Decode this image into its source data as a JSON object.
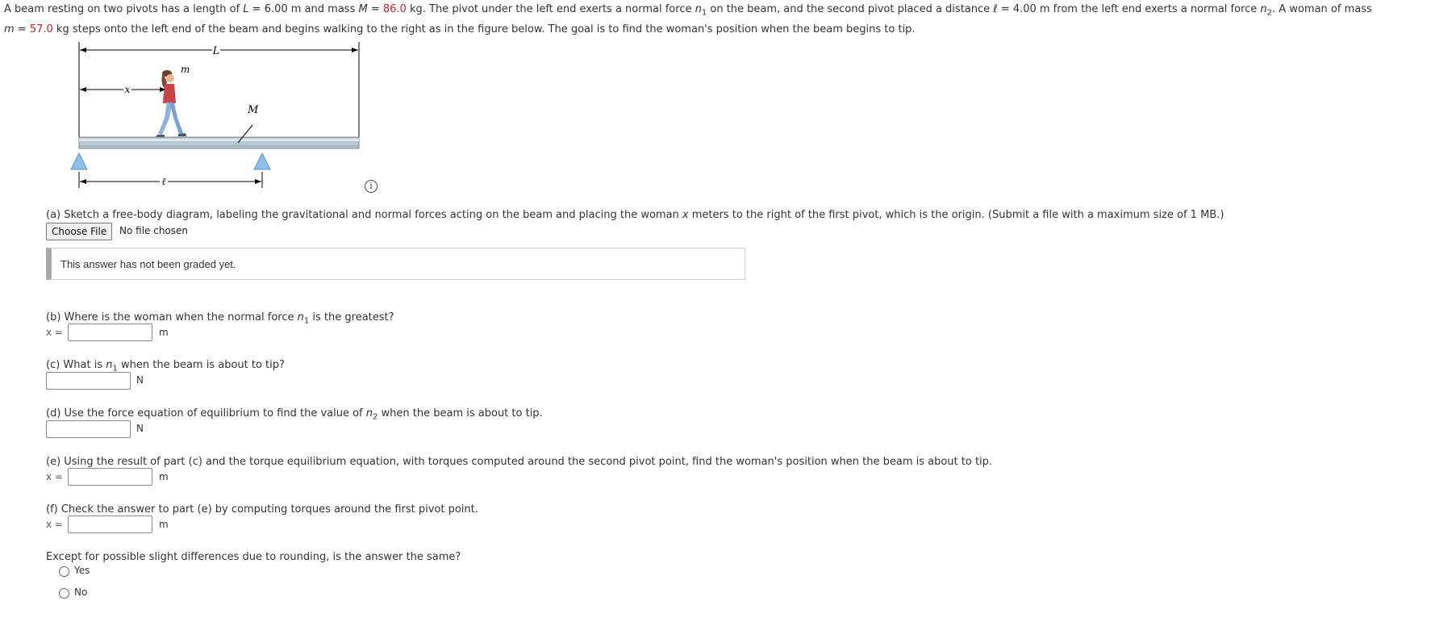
{
  "intro": {
    "p1": "A beam resting on two pivots has a length of ",
    "L_var": "L",
    "L_eq": " = 6.00 m and mass ",
    "M_var": "M",
    "M_eq": " = ",
    "M_val": "86.0",
    "p2": " kg. The pivot under the left end exerts a normal force ",
    "n_var": "n",
    "n1_sub": "1",
    "p3": " on the beam, and the second pivot placed a distance ",
    "ell_var": "ℓ",
    "p4": " = 4.00 m from the left end exerts a normal force ",
    "n2_var": "n",
    "n2_sub": "2",
    "p5": ". A woman of mass ",
    "m_var": "m",
    "m_eq": " = ",
    "m_val": "57.0",
    "p6": " kg steps onto the left end of the beam and begins walking to the right as in the figure below. The goal is to find the woman's position when the beam begins to tip."
  },
  "figure": {
    "L_label": "L",
    "x_label": "x",
    "m_label": "m",
    "M_label": "M",
    "ell_label": "ℓ"
  },
  "info_icon": "i",
  "part_a": {
    "text": "(a) Sketch a free-body diagram, labeling the gravitational and normal forces acting on the beam and placing the woman ",
    "var": "x",
    "text2": " meters to the right of the first pivot, which is the origin. (Submit a file with a maximum size of 1 MB.)",
    "button": "Choose File",
    "file_status": "No file chosen",
    "graded_msg": "This answer has not been graded yet."
  },
  "part_b": {
    "text": "(b) Where is the woman when the normal force ",
    "var": "n",
    "sub": "1",
    "text2": " is the greatest?",
    "x_label": "x =",
    "unit": "m"
  },
  "part_c": {
    "text": "(c) What is ",
    "var": "n",
    "sub": "1",
    "text2": " when the beam is about to tip?",
    "unit": "N"
  },
  "part_d": {
    "text": "(d) Use the force equation of equilibrium to find the value of ",
    "var": "n",
    "sub": "2",
    "text2": " when the beam is about to tip.",
    "unit": "N"
  },
  "part_e": {
    "text": "(e) Using the result of part (c) and the torque equilibrium equation, with torques computed around the second pivot point, find the woman's position when the beam is about to tip.",
    "x_label": "x =",
    "unit": "m"
  },
  "part_f": {
    "text": "(f) Check the answer to part (e) by computing torques around the first pivot point.",
    "x_label": "x =",
    "unit": "m"
  },
  "question_same": {
    "text": "Except for possible slight differences due to rounding, is the answer the same?",
    "options": [
      "Yes",
      "No"
    ]
  }
}
